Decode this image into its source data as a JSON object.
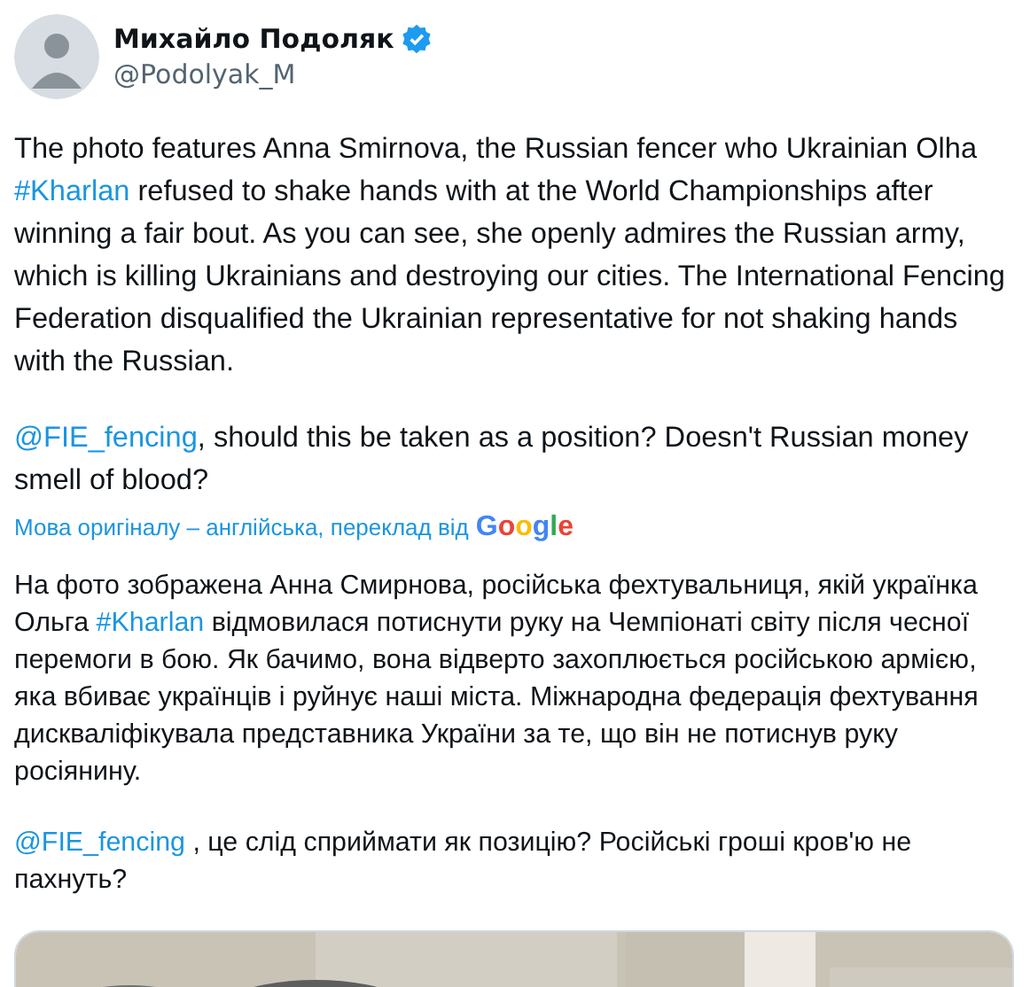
{
  "author": {
    "name": "Михайло Подоляк",
    "verified": true,
    "handle": "@Podolyak_M"
  },
  "original_text": [
    [
      {
        "kind": "text",
        "text": "The photo features Anna Smirnova, the Russian fencer who Ukrainian Olha "
      },
      {
        "kind": "link",
        "text": "#Kharlan"
      },
      {
        "kind": "text",
        "text": " refused to shake hands with at the World Championships after winning a fair bout. As you can see, she openly admires the Russian army, which is killing Ukrainians and destroying our cities. The International Fencing Federation disqualified the Ukrainian representative for not shaking hands with the Russian."
      }
    ],
    [
      {
        "kind": "link",
        "text": "@FIE_fencing"
      },
      {
        "kind": "text",
        "text": ", should this be taken as a position? Doesn't Russian money smell of blood?"
      }
    ]
  ],
  "translation_note": {
    "text": "Мова оригіналу – англійська, переклад від",
    "logo": "Google"
  },
  "translated_text": [
    [
      {
        "kind": "text",
        "text": "На фото зображена Анна Смирнова, російська фехтувальниця, якій українка Ольга "
      },
      {
        "kind": "link",
        "text": "#Kharlan"
      },
      {
        "kind": "text",
        "text": " відмовилася потиснути руку на Чемпіонаті світу після чесної перемоги в бою. Як бачимо, вона відверто захоплюється російською армією, яка вбиває українців і руйнує наші міста. Міжнародна федерація фехтування дискваліфікувала представника України за те, що він не потиснув руку росіянину."
      }
    ],
    [
      {
        "kind": "link",
        "text": "@FIE_fencing"
      },
      {
        "kind": "text",
        "text": " , це слід сприймати як позицію? Російські гроші кров'ю не пахнуть?"
      }
    ]
  ],
  "media": {
    "kind": "picture"
  }
}
